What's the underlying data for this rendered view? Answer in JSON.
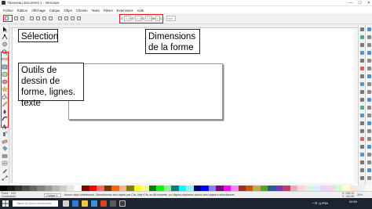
{
  "window": {
    "title": "*Nouveau document 1 - Inkscape",
    "buttons": [
      "—",
      "☐",
      "✕"
    ]
  },
  "menu": [
    "Fichier",
    "Édition",
    "Affichage",
    "Calque",
    "Objet",
    "Chemin",
    "Texte",
    "Filtres",
    "Extensions",
    "Aide"
  ],
  "tool_controls": {
    "fields": [
      {
        "label": "X",
        "value": "0,000"
      },
      {
        "label": "Y",
        "value": "0,000"
      },
      {
        "label": "L",
        "value": "0,000"
      },
      {
        "label": "H",
        "value": "0,000"
      }
    ],
    "unit": "mm"
  },
  "annotations": {
    "selection": "Sélection",
    "dimensions": "Dimensions de la forme",
    "tools": "Outils de dessin de forme, lignes. texte"
  },
  "highlight_color": "#e2181f",
  "tools": [
    "selector-icon",
    "node-icon",
    "tweak-icon",
    "zoom-icon",
    "measure-icon",
    "rectangle-icon",
    "box3d-icon",
    "ellipse-icon",
    "star-icon",
    "spiral-icon",
    "pencil-icon",
    "pen-icon",
    "calligraphy-icon",
    "text-icon",
    "spray-icon",
    "eraser-icon",
    "bucket-icon",
    "gradient-icon",
    "mesh-icon",
    "dropper-icon",
    "connector-icon"
  ],
  "status": {
    "fill_label": "Fond :",
    "stroke_label": "Contour :",
    "fill_value": "N/A",
    "stroke_value": "N/A",
    "layer": "-Calque 1",
    "message": "Aucun objet sélectionné. Sélectionnez des objets par Clic, Maj+Clic ou Alt+molette, ou cliquez-déplacez autour des objets à sélectionner.",
    "coords_x": "X: 206,31",
    "coords_y": "Y: 164,89",
    "zoom": "35%"
  },
  "taskbar": {
    "search_placeholder": "Taper ici pour rechercher",
    "tray": "^ ⊡ ◃) FRA",
    "time": "09:50",
    "date": ""
  },
  "palette": [
    "#000000",
    "#1a1a1a",
    "#333333",
    "#4d4d4d",
    "#666666",
    "#808080",
    "#999999",
    "#b3b3b3",
    "#cccccc",
    "#e6e6e6",
    "#ffffff",
    "#800000",
    "#ff0000",
    "#ff6666",
    "#803300",
    "#ff6600",
    "#ffb380",
    "#808000",
    "#ffff00",
    "#ffff80",
    "#008000",
    "#00ff00",
    "#80ff80",
    "#008080",
    "#00ffff",
    "#80ffff",
    "#000080",
    "#0000ff",
    "#8080ff",
    "#800080",
    "#ff00ff",
    "#ff80ff",
    "#a02c2c",
    "#d45500",
    "#c8ab37",
    "#5aa02c",
    "#2c5aa0",
    "#7137c8",
    "#c83771",
    "#e9afaf",
    "#ffd5d5",
    "#d7f4d7",
    "#d7eef4",
    "#e5d5ff",
    "#f4d7ee",
    "#ccffcc",
    "#ffffcc",
    "#ffe6d5",
    "#eeeeee",
    "#f9f9f9"
  ]
}
